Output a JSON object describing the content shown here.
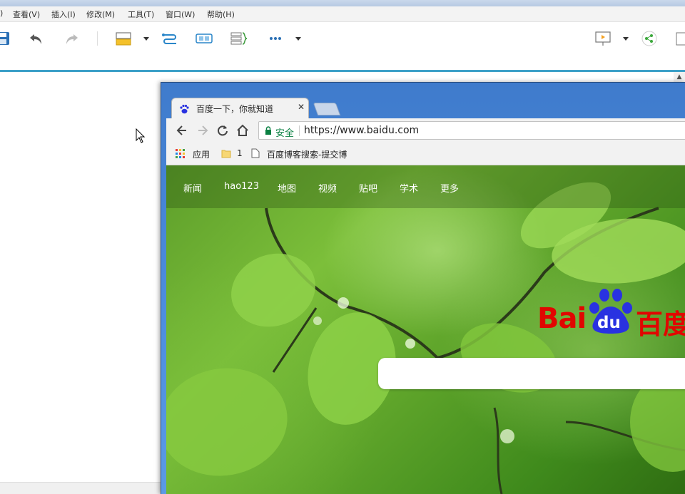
{
  "app": {
    "menu": [
      {
        "label": ")"
      },
      {
        "label": "查看(V)"
      },
      {
        "label": "插入(I)"
      },
      {
        "label": "修改(M)"
      },
      {
        "label": "工具(T)"
      },
      {
        "label": "窗口(W)"
      },
      {
        "label": "帮助(H)"
      }
    ],
    "scroll_up_glyph": "▲"
  },
  "browser": {
    "tab_title": "百度一下，你就知道",
    "tab_close": "✕",
    "security_label": "安全",
    "url": "https://www.baidu.com",
    "bookmarks": [
      {
        "label": "应用",
        "icon": "apps-grid-icon"
      },
      {
        "label": "1",
        "icon": "folder-icon"
      },
      {
        "label": "百度博客搜索-提交博",
        "icon": "page-icon"
      }
    ]
  },
  "page": {
    "nav_links": [
      "新闻",
      "hao123",
      "地图",
      "视频",
      "贴吧",
      "学术",
      "更多"
    ],
    "logo": {
      "latin_left": "Bai",
      "latin_in_paw": "du",
      "chinese": "百度"
    },
    "search_value": ""
  },
  "colors": {
    "accent": "#3ca0c8",
    "baidu_red": "#e10601",
    "baidu_blue": "#2932e1",
    "secure_green": "#0b8043"
  }
}
